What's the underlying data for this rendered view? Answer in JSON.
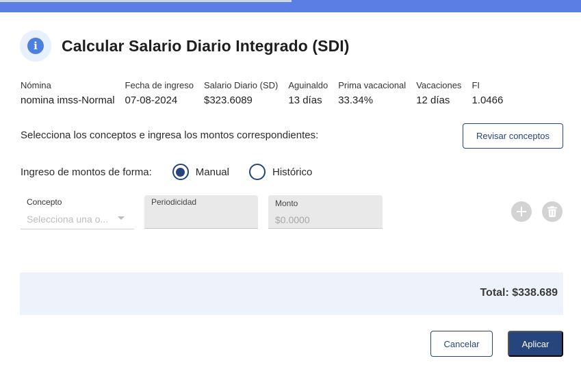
{
  "dialog": {
    "title": "Calcular Salario Diario Integrado (SDI)",
    "icon": "info-icon"
  },
  "info": [
    {
      "label": "Nómina",
      "value": "nomina imss-Normal"
    },
    {
      "label": "Fecha de ingreso",
      "value": "07-08-2024"
    },
    {
      "label": "Salario Diario (SD)",
      "value": "$323.6089"
    },
    {
      "label": "Aguinaldo",
      "value": "13 días"
    },
    {
      "label": "Prima vacacional",
      "value": "33.34%"
    },
    {
      "label": "Vacaciones",
      "value": "12 días"
    },
    {
      "label": "FI",
      "value": "1.0466"
    }
  ],
  "prompt": "Selecciona los conceptos e ingresa los montos correspondientes:",
  "review_button": "Revisar conceptos",
  "mode": {
    "label": "Ingreso de montos de forma:",
    "options": [
      "Manual",
      "Histórico"
    ],
    "selected": "Manual"
  },
  "fields": {
    "concepto_label": "Concepto",
    "concepto_placeholder": "Selecciona una o...",
    "periodicidad_label": "Periodicidad",
    "monto_label": "Monto",
    "monto_value": "$0.0000"
  },
  "total": "Total: $338.689",
  "actions": {
    "cancel": "Cancelar",
    "apply": "Aplicar"
  },
  "colors": {
    "accent": "#27457d",
    "top_bar": "#5b7ee5",
    "total_bg": "#eef3fb"
  }
}
